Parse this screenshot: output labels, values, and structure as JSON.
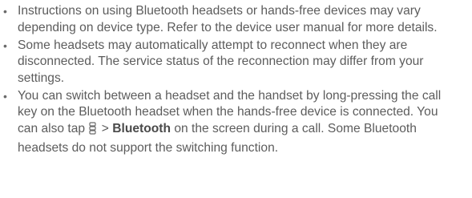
{
  "notes": [
    {
      "text": "Instructions on using Bluetooth headsets or hands-free devices may vary depending on device type. Refer to the device user manual for more details."
    },
    {
      "text": "Some headsets may automatically attempt to reconnect when they are disconnected. The service status of the reconnection may differ from your settings."
    },
    {
      "text_before_icon": "You can switch between a headset and the handset by long-pressing the call key on the Bluetooth headset when the hands-free device is connected. You can also tap",
      "icon": "menu-icon",
      "separator": ">",
      "bold_text": "Bluetooth",
      "text_after": "on the screen during a call. Some Bluetooth headsets do not support the switching function."
    }
  ],
  "bullet_glyph": "•"
}
